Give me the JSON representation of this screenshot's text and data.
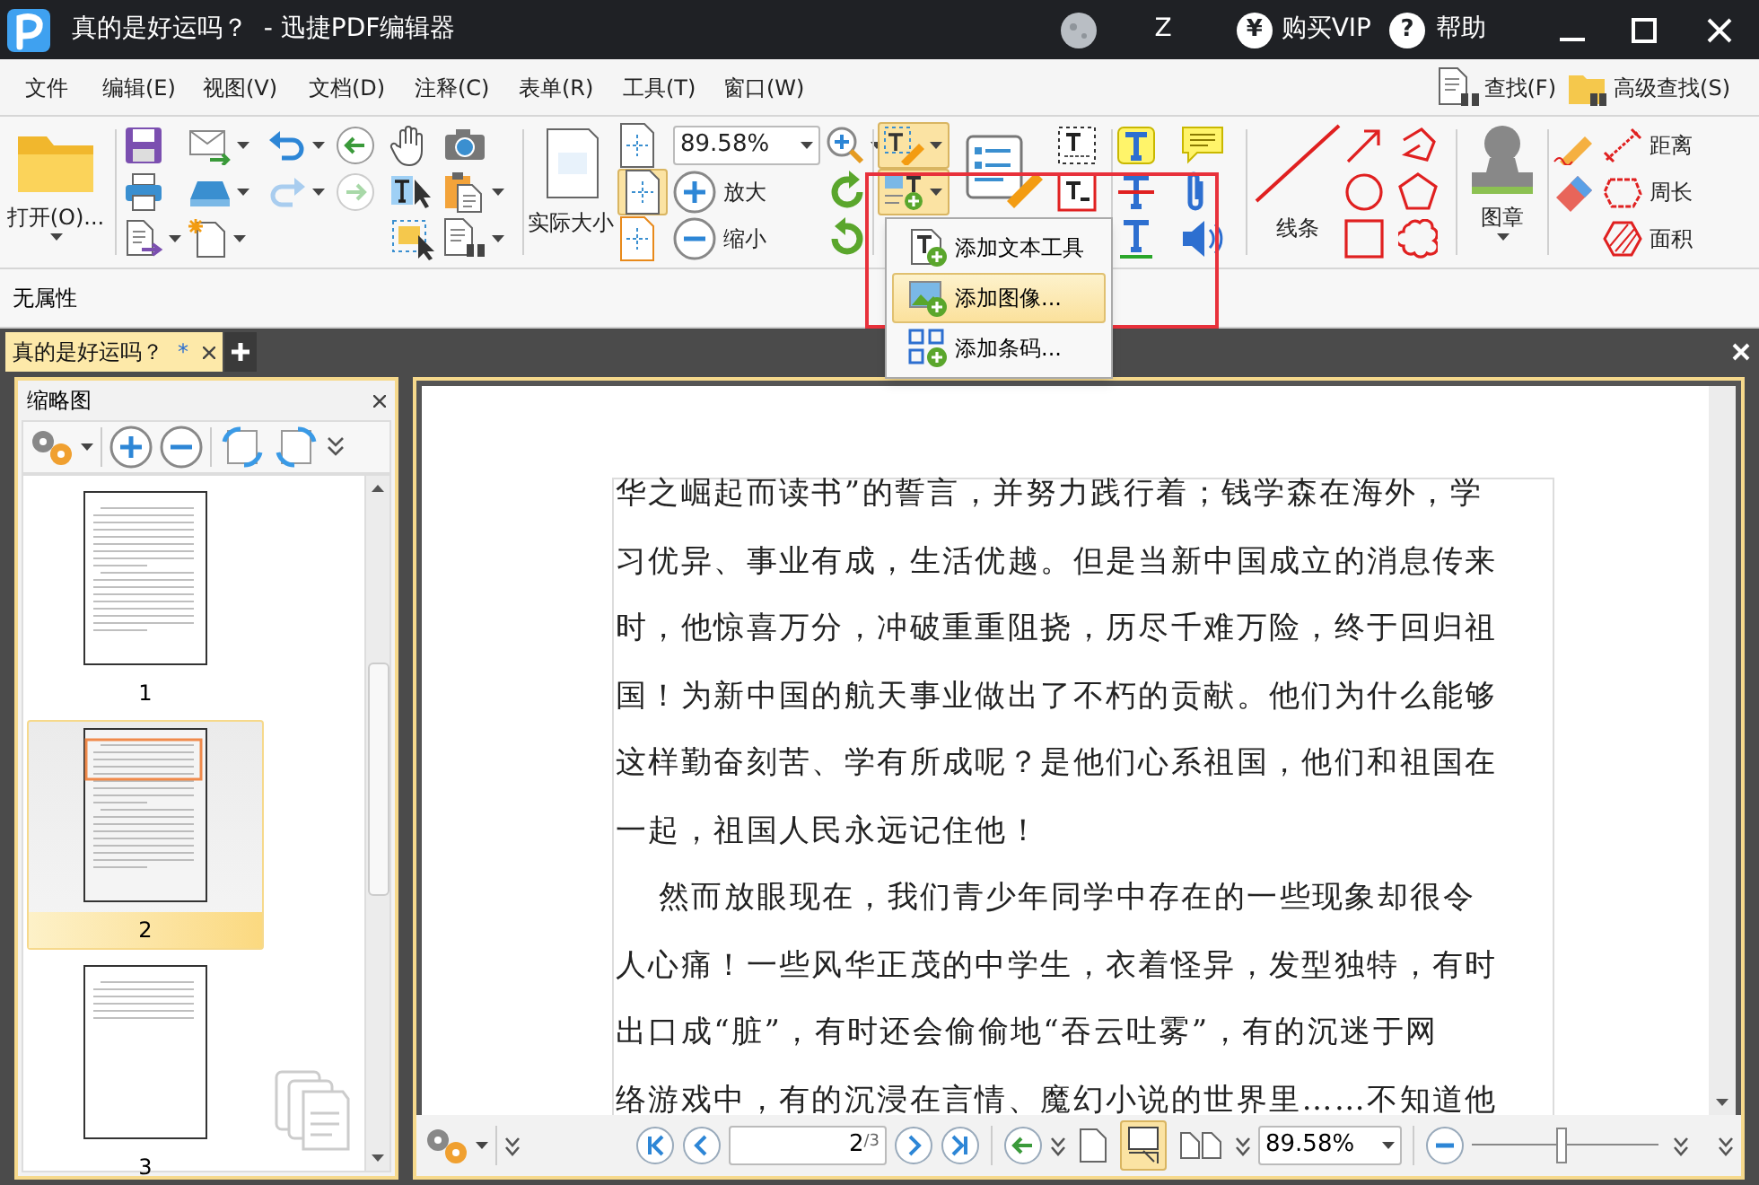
{
  "title_bar": {
    "app_title": "真的是好运吗？  - 迅捷PDF编辑器",
    "user": "Z",
    "vip_glyph": "¥",
    "buy_vip": "购买VIP",
    "help_glyph": "?",
    "help": "帮助"
  },
  "menu_bar": {
    "items": [
      "文件",
      "编辑(E)",
      "视图(V)",
      "文档(D)",
      "注释(C)",
      "表单(R)",
      "工具(T)",
      "窗口(W)"
    ],
    "find": "查找(F)",
    "advanced_find": "高级查找(S)"
  },
  "ribbon": {
    "open": "打开(O)...",
    "zoom_value": "89.58%",
    "actual_size": "实际大小",
    "zoom_in": "放大",
    "zoom_out": "缩小",
    "lines": "线条",
    "stamp": "图章",
    "measure": [
      "距离",
      "周长",
      "面积"
    ]
  },
  "property_bar": {
    "text": "无属性"
  },
  "document_tabs": [
    {
      "label": "真的是好运吗？",
      "modified_mark": "*",
      "selected": true
    }
  ],
  "dropdown_menu": [
    {
      "kind": "text",
      "label": "添加文本工具",
      "selected": false
    },
    {
      "kind": "image",
      "label": "添加图像...",
      "selected": true
    },
    {
      "kind": "barcode",
      "label": "添加条码...",
      "selected": false
    }
  ],
  "thumbnail_panel": {
    "title": "缩略图",
    "pages": [
      {
        "label": "1",
        "selected": false
      },
      {
        "label": "2",
        "selected": true
      },
      {
        "label": "3",
        "selected": false
      }
    ]
  },
  "document": {
    "paragraphs": [
      {
        "indented": false,
        "lines": [
          "华之崛起而读书”的誓言，并努力践行着；钱学森在海外，学",
          "习优异、事业有成，生活优越。但是当新中国成立的消息传来",
          "时，他惊喜万分，冲破重重阻挠，历尽千难万险，终于回归祖",
          "国！为新中国的航天事业做出了不朽的贡献。他们为什么能够",
          "这样勤奋刻苦、学有所成呢？是他们心系祖国，他们和祖国在",
          "一起，祖国人民永远记住他！"
        ]
      },
      {
        "indented": true,
        "lines": [
          "然而放眼现在，我们青少年同学中存在的一些现象却很令",
          "人心痛！一些风华正茂的中学生，衣着怪异，发型独特，有时",
          "出口成“脏”，有时还会偷偷地“吞云吐雾”，有的沉迷于网",
          "络游戏中，有的沉浸在言情、魔幻小说的世界里……不知道他"
        ]
      }
    ]
  },
  "bottom_bar": {
    "page_value": "2",
    "page_count": "/3",
    "page_layouts": [
      {
        "kind": "single",
        "selected": false
      },
      {
        "kind": "continuous",
        "selected": true
      },
      {
        "kind": "facing",
        "selected": false
      }
    ],
    "zoom_value": "89.58%",
    "zoom_slider": {
      "level": 0.48
    }
  }
}
